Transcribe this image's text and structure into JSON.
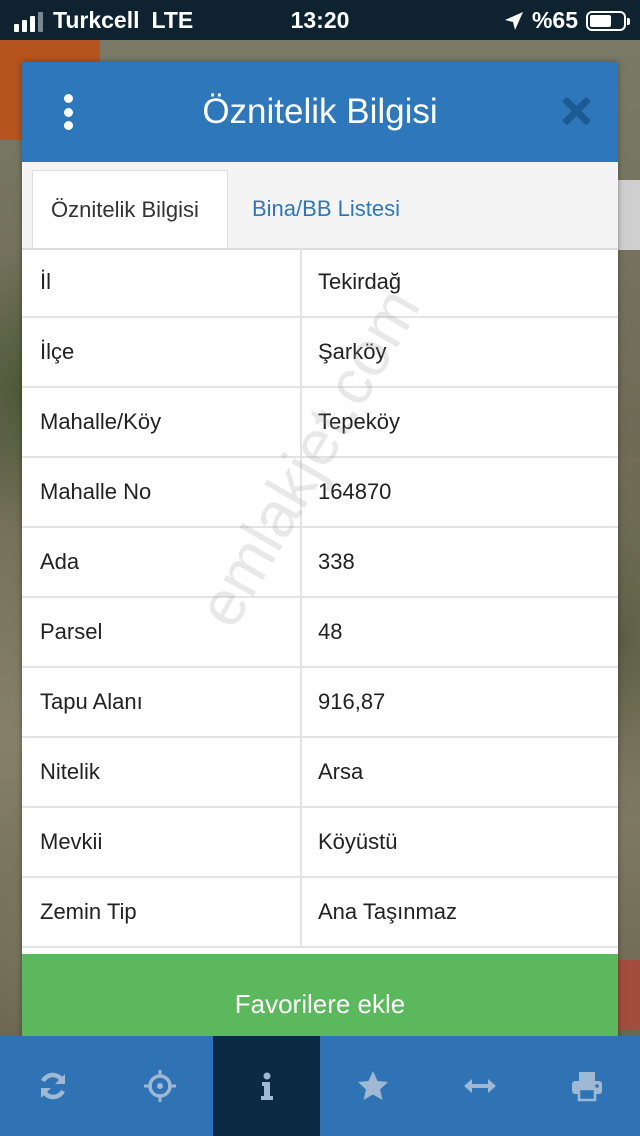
{
  "status": {
    "carrier": "Turkcell",
    "network": "LTE",
    "time": "13:20",
    "battery": "%65",
    "battery_level": 65
  },
  "modal": {
    "title": "Öznitelik Bilgisi",
    "tabs": [
      {
        "label": "Öznitelik Bilgisi",
        "active": true
      },
      {
        "label": "Bina/BB Listesi",
        "active": false
      }
    ],
    "rows": [
      {
        "key": "İl",
        "value": "Tekirdağ"
      },
      {
        "key": "İlçe",
        "value": "Şarköy"
      },
      {
        "key": "Mahalle/Köy",
        "value": "Tepeköy"
      },
      {
        "key": "Mahalle No",
        "value": "164870"
      },
      {
        "key": "Ada",
        "value": "338"
      },
      {
        "key": "Parsel",
        "value": "48"
      },
      {
        "key": "Tapu Alanı",
        "value": "916,87"
      },
      {
        "key": "Nitelik",
        "value": "Arsa"
      },
      {
        "key": "Mevkii",
        "value": "Köyüstü"
      },
      {
        "key": "Zemin Tip",
        "value": "Ana Taşınmaz"
      }
    ],
    "watermark": "emlakjet.com",
    "favorite_button": "Favorilere ekle"
  },
  "toolbar": {
    "icons": [
      "refresh-icon",
      "crosshair-icon",
      "info-icon",
      "star-icon",
      "measure-icon",
      "print-icon"
    ],
    "active_index": 2
  },
  "colors": {
    "header": "#2e77bb",
    "favorite": "#5cb85c",
    "toolbar": "#2f73b4",
    "toolbar_active": "#0d2a45"
  }
}
